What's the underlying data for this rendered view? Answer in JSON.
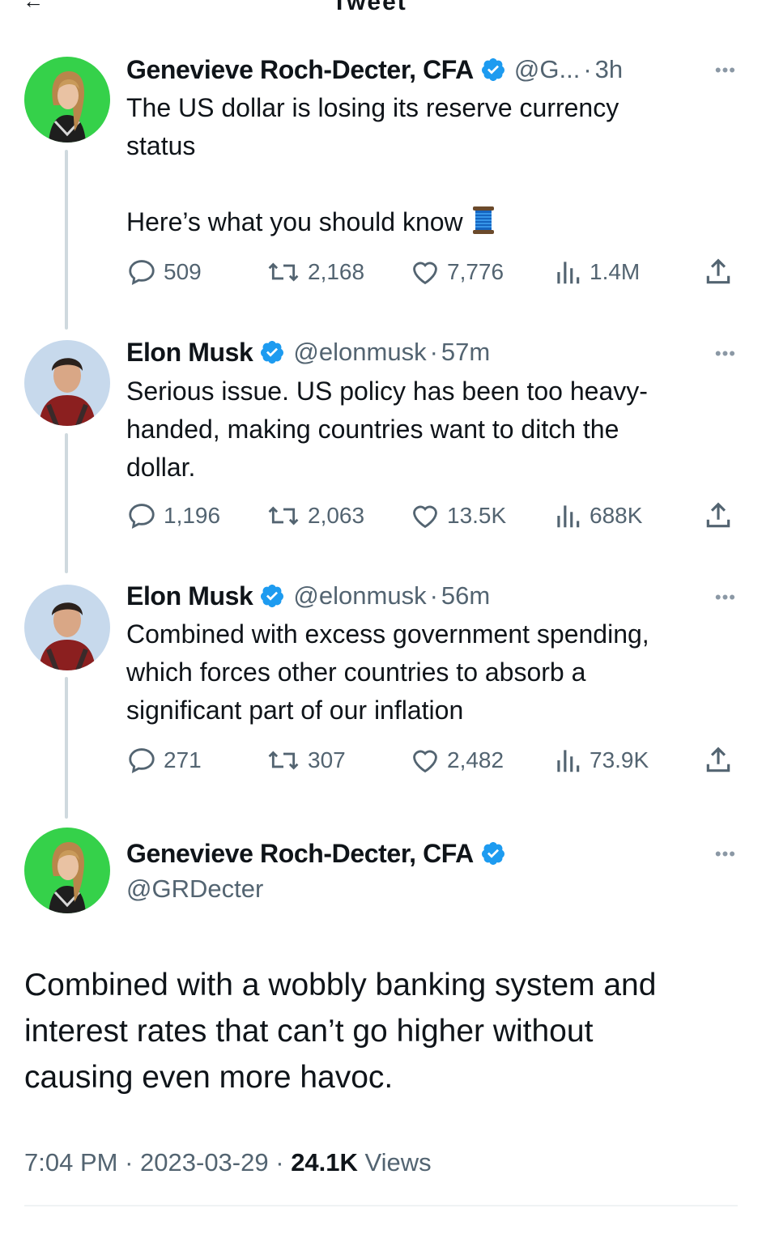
{
  "header": {
    "title": "Tweet"
  },
  "thread": [
    {
      "name": "Genevieve Roch-Decter, CFA",
      "handle": "@G...",
      "time": "3h",
      "text_lines": [
        "The US dollar is losing its reserve currency",
        "status",
        "",
        "Here’s what you should know"
      ],
      "replies": "509",
      "retweets": "2,168",
      "likes": "7,776",
      "views": "1.4M"
    },
    {
      "name": "Elon Musk",
      "handle": "@elonmusk",
      "time": "57m",
      "text_lines": [
        "Serious issue. US policy has been too heavy-",
        "handed, making countries want to ditch the",
        "dollar."
      ],
      "replies": "1,196",
      "retweets": "2,063",
      "likes": "13.5K",
      "views": "688K"
    },
    {
      "name": "Elon Musk",
      "handle": "@elonmusk",
      "time": "56m",
      "text_lines": [
        "Combined with excess government spending,",
        "which forces other countries to absorb a",
        "significant part of our inflation"
      ],
      "replies": "271",
      "retweets": "307",
      "likes": "2,482",
      "views": "73.9K"
    }
  ],
  "main_tweet": {
    "name": "Genevieve Roch-Decter, CFA",
    "handle": "@GRDecter",
    "text_lines": [
      "Combined with a wobbly banking system and",
      "interest rates that can’t go higher without",
      "causing even more havoc."
    ],
    "time": "7:04 PM",
    "date": "2023-03-29",
    "views_count": "24.1K",
    "views_label": "Views"
  },
  "ui": {
    "more": "•••",
    "separator": "·"
  },
  "colors": {
    "verified": "#1d9bf0",
    "secondary_text": "#536471",
    "thread_line": "#cfd9de",
    "genevieve_avatar_bg": "#35d14a"
  },
  "icons": [
    "back-arrow-icon",
    "reply-icon",
    "retweet-icon",
    "like-icon",
    "views-icon",
    "share-icon",
    "verified-icon",
    "more-icon",
    "thread-spool-icon"
  ]
}
